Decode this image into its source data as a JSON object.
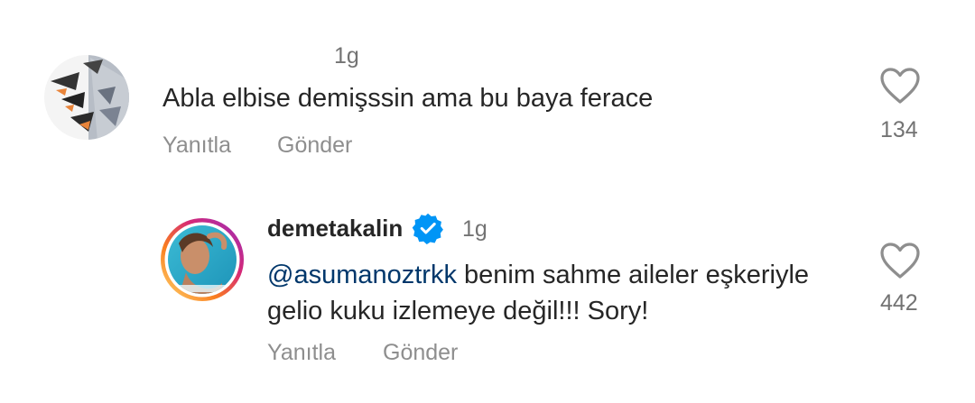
{
  "comments": [
    {
      "username": "",
      "time": "1g",
      "text": "Abla elbise demişssin ama bu baya ferace",
      "reply_label": "Yanıtla",
      "send_label": "Gönder",
      "likes": "134",
      "avatar_icon": "sketch-avatar"
    },
    {
      "username": "demetakalin",
      "verified": true,
      "time": "1g",
      "mention": "@asumanoztrkk",
      "text": " benim sahme aileler eşkeriyle gelio kuku izlemeye değil!!! Sory!",
      "reply_label": "Yanıtla",
      "send_label": "Gönder",
      "likes": "442",
      "avatar_icon": "story-ring-avatar"
    }
  ],
  "colors": {
    "text": "#262626",
    "secondary": "#8e8e8e",
    "mention": "#00376b",
    "verified": "#0095f6"
  }
}
